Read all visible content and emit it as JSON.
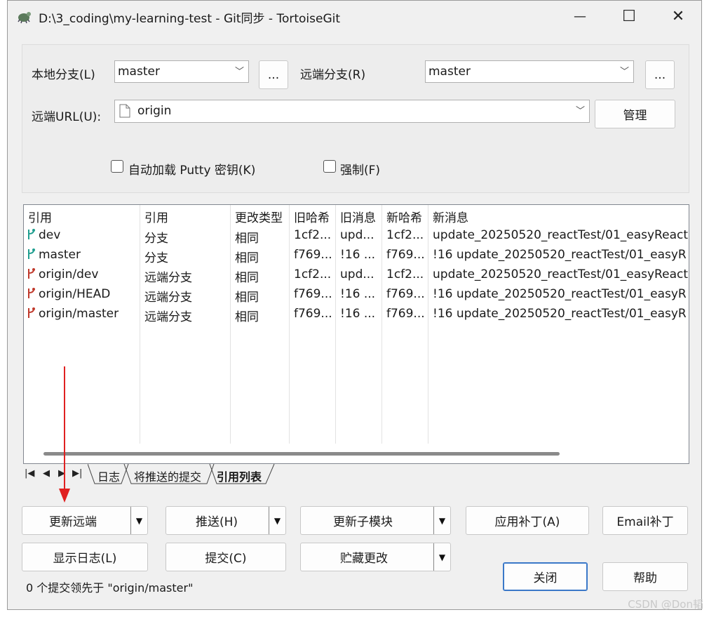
{
  "window": {
    "title": "D:\\3_coding\\my-learning-test - Git同步 - TortoiseGit",
    "minimize": "—",
    "maximize": "☐",
    "close": "✕"
  },
  "local_branch": {
    "label": "本地分支(L)",
    "value": "master",
    "more": "..."
  },
  "remote_branch": {
    "label": "远端分支(R)",
    "value": "master",
    "more": "..."
  },
  "remote_url": {
    "label": "远端URL(U):",
    "value": "origin",
    "manage": "管理"
  },
  "checkboxes": {
    "putty": "自动加载 Putty 密钥(K)",
    "force": "强制(F)"
  },
  "table": {
    "headers": [
      "引用",
      "引用",
      "更改类型",
      "旧哈希",
      "旧消息",
      "新哈希",
      "新消息"
    ],
    "rows": [
      [
        "dev",
        "分支",
        "相同",
        "1cf2...",
        "upd...",
        "1cf2...",
        "update_20250520_reactTest/01_easyReact"
      ],
      [
        "master",
        "分支",
        "相同",
        "f769...",
        "!16 ...",
        "f769...",
        "!16 update_20250520_reactTest/01_easyR"
      ],
      [
        "origin/dev",
        "远端分支",
        "相同",
        "1cf2...",
        "upd...",
        "1cf2...",
        "update_20250520_reactTest/01_easyReact"
      ],
      [
        "origin/HEAD",
        "远端分支",
        "相同",
        "f769...",
        "!16 ...",
        "f769...",
        "!16 update_20250520_reactTest/01_easyR"
      ],
      [
        "origin/master",
        "远端分支",
        "相同",
        "f769...",
        "!16 ...",
        "f769...",
        "!16 update_20250520_reactTest/01_easyR"
      ]
    ]
  },
  "tabs": [
    "日志",
    "将推送的提交",
    "引用列表"
  ],
  "buttons": {
    "fetch": "更新远端",
    "push": "推送(H)",
    "submodule": "更新子模块",
    "apply_patch": "应用补丁(A)",
    "email_patch": "Email补丁",
    "show_log": "显示日志(L)",
    "commit": "提交(C)",
    "stash": "贮藏更改",
    "close": "关闭",
    "help": "帮助"
  },
  "status": "0 个提交领先于 \"origin/master\"",
  "watermark": "CSDN @Don韬",
  "colors": {
    "local_icon": "#1f9e8f",
    "remote_icon": "#c0392b",
    "arrow": "#e02020",
    "accent_border": "#3a78c8"
  }
}
